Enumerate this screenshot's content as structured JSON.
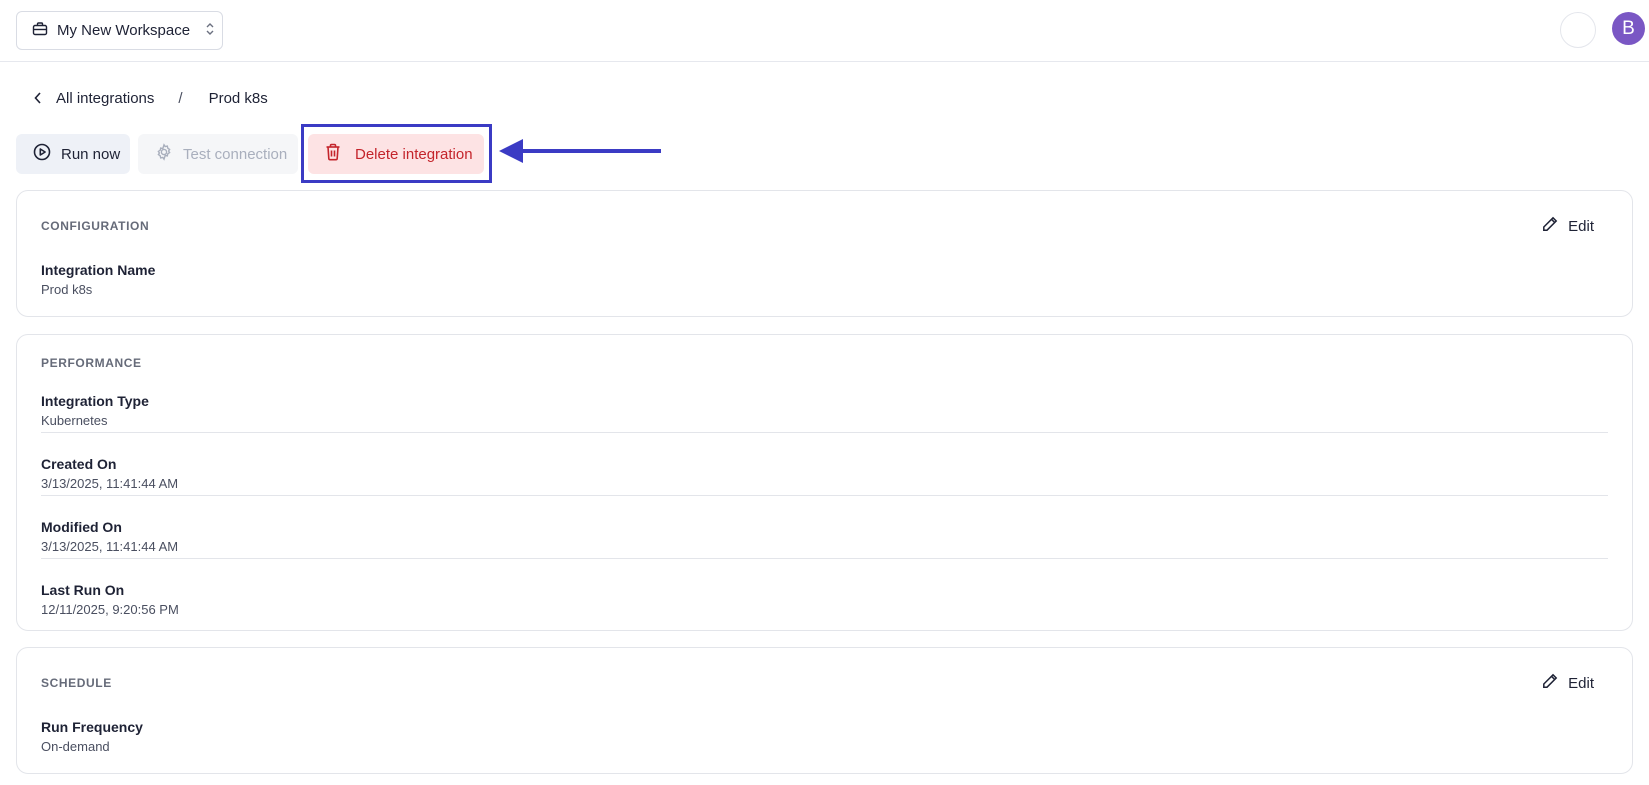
{
  "header": {
    "workspace_name": "My New Workspace",
    "avatar_initial": "B"
  },
  "breadcrumb": {
    "parent": "All integrations",
    "separator": "/",
    "current": "Prod k8s"
  },
  "actions": {
    "run_now": "Run now",
    "test_connection": "Test connection",
    "delete_integration": "Delete integration"
  },
  "configuration": {
    "title": "CONFIGURATION",
    "edit_label": "Edit",
    "fields": [
      {
        "label": "Integration Name",
        "value": "Prod k8s"
      }
    ]
  },
  "performance": {
    "title": "PERFORMANCE",
    "fields": [
      {
        "label": "Integration Type",
        "value": "Kubernetes"
      },
      {
        "label": "Created On",
        "value": "3/13/2025, 11:41:44 AM"
      },
      {
        "label": "Modified On",
        "value": "3/13/2025, 11:41:44 AM"
      },
      {
        "label": "Last Run On",
        "value": "12/11/2025, 9:20:56 PM"
      }
    ]
  },
  "schedule": {
    "title": "SCHEDULE",
    "edit_label": "Edit",
    "fields": [
      {
        "label": "Run Frequency",
        "value": "On-demand"
      }
    ]
  },
  "colors": {
    "accent": "#3b3bc4",
    "danger": "#c4242b",
    "danger_bg": "#fde3e4",
    "avatar": "#7a57c4"
  }
}
